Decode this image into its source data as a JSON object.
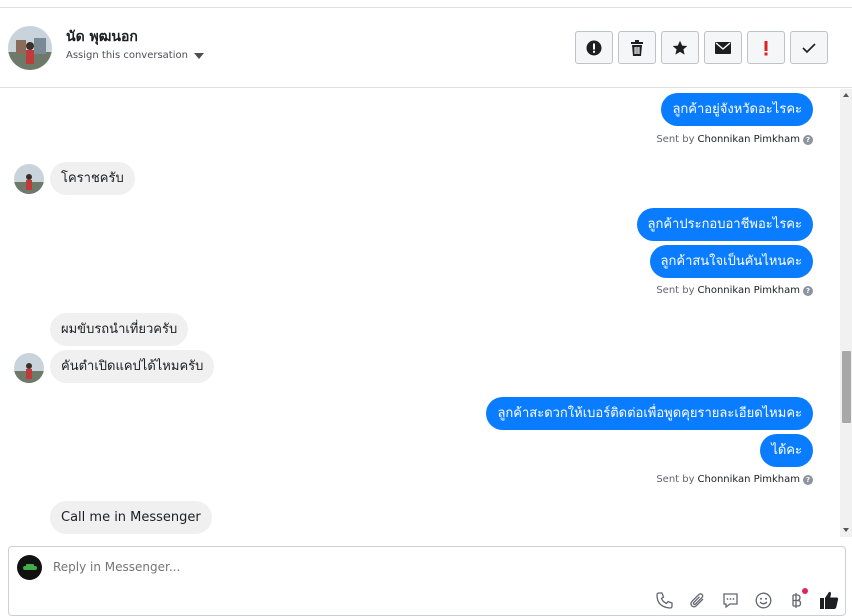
{
  "header": {
    "name": "นัด พุฒนอก",
    "assign_label": "Assign this conversation",
    "actions": [
      {
        "icon": "exclamation-circle-icon"
      },
      {
        "icon": "trash-icon"
      },
      {
        "icon": "star-icon"
      },
      {
        "icon": "envelope-icon"
      },
      {
        "icon": "red-exclamation-icon",
        "color": "#e02020"
      },
      {
        "icon": "checkmark-icon"
      }
    ]
  },
  "messages": {
    "m1": "ลูกค้าอยู่จังหวัดอะไรคะ",
    "m2": "โคราชครับ",
    "m3": "ลูกค้าประกอบอาชีพอะไรคะ",
    "m4": "ลูกค้าสนใจเป็นคันไหนคะ",
    "m5": "ผมขับรถนำเที่ยวครับ",
    "m6": "คันตำเปิดแคปได้ไหมครับ",
    "m7": "ลูกค้าสะดวกให้เบอร์ติดต่อเพื่อพูดคุยรายละเอียดไหมคะ",
    "m8": "ได้คะ",
    "m9": "Call me in Messenger"
  },
  "sent_by": {
    "prefix": "Sent by",
    "name": "Chonnikan Pimkham"
  },
  "composer": {
    "placeholder": "Reply in Messenger...",
    "tools": [
      "phone-icon",
      "paperclip-icon",
      "chat-bubble-icon",
      "emoji-icon",
      "baht-icon",
      "thumbs-up-icon"
    ]
  },
  "colors": {
    "outgoing": "#0a7cff",
    "incoming": "#f0f0f0",
    "notification_dot": "#e0245e"
  }
}
